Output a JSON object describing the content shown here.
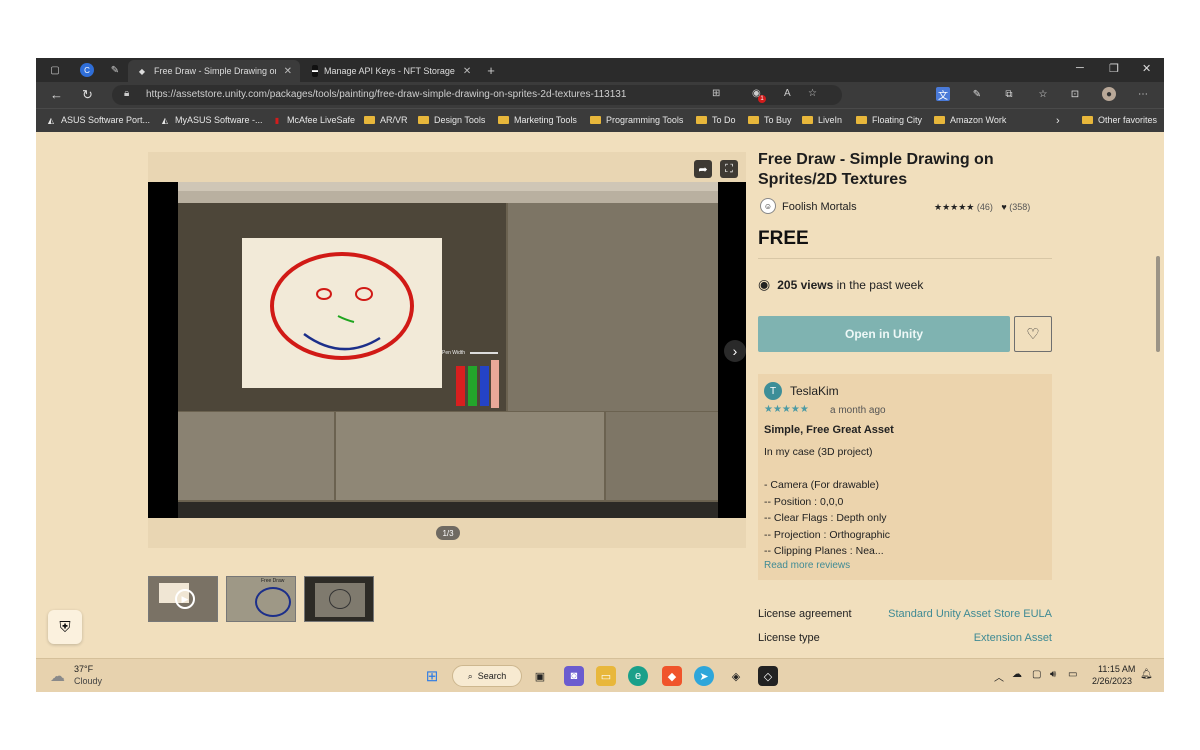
{
  "browser": {
    "tabs": [
      {
        "label": "Free Draw - Simple Drawing on",
        "active": true
      },
      {
        "label": "Manage API Keys - NFT Storage",
        "active": false
      }
    ],
    "url": "https://assetstore.unity.com/packages/tools/painting/free-draw-simple-drawing-on-sprites-2d-textures-113131",
    "extension_badge": "1",
    "bookmarks": [
      "ASUS Software Port...",
      "MyASUS Software -...",
      "McAfee LiveSafe",
      "AR/VR",
      "Design Tools",
      "Marketing Tools",
      "Programming Tools",
      "To Do",
      "To Buy",
      "LiveIn",
      "Floating City",
      "Amazon Work"
    ],
    "other_favorites": "Other favorites"
  },
  "product": {
    "title": "Free Draw - Simple Drawing on Sprites/2D Textures",
    "publisher": "Foolish Mortals",
    "stars": "★★★★★",
    "rating_count": "(46)",
    "favorites_count": "(358)",
    "price": "FREE",
    "views_bold": "205 views",
    "views_rest": " in the past week",
    "open_button": "Open in Unity",
    "gallery_pager": "1/3"
  },
  "review": {
    "avatar_letter": "T",
    "reviewer": "TeslaKim",
    "stars": "★★★★★",
    "date": "a month ago",
    "title": "Simple, Free Great Asset",
    "body": "In my case (3D project)\n\n- Camera (For drawable)\n-- Position : 0,0,0\n-- Clear Flags : Depth only\n-- Projection : Orthographic\n-- Clipping Planes : Nea...",
    "read_more": "Read more reviews"
  },
  "license": {
    "agreement_label": "License agreement",
    "agreement_value": "Standard Unity Asset Store EULA",
    "type_label": "License type",
    "type_value": "Extension Asset"
  },
  "screenshot_overlay": {
    "pen_width": "Pen Width",
    "thumb_caption": "Free Draw"
  },
  "taskbar": {
    "weather_temp": "37°F",
    "weather_desc": "Cloudy",
    "search_label": "Search",
    "time": "11:15 AM",
    "date": "2/26/2023"
  },
  "colors": {
    "page_bg": "#f1dfbd",
    "accent": "#7fb3b1",
    "link": "#3f8a94"
  }
}
